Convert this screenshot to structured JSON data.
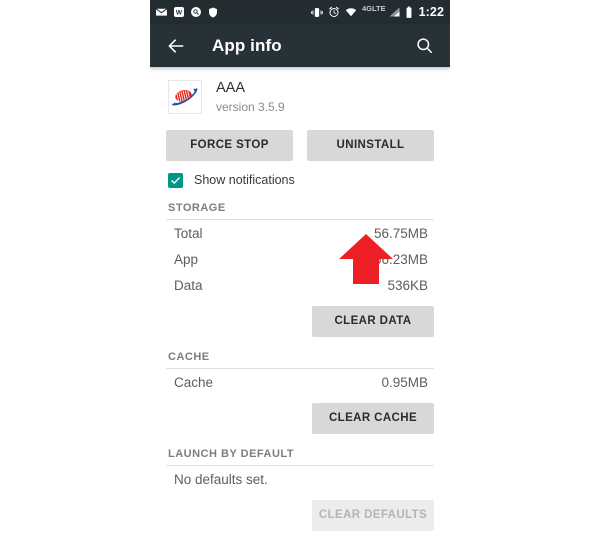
{
  "status_bar": {
    "icons_left": [
      "mail-icon",
      "w-app-icon",
      "eye-search-icon",
      "shield-icon"
    ],
    "icons_right": [
      "vibrate-icon",
      "alarm-icon",
      "wifi-icon",
      "signal-icon",
      "battery-icon"
    ],
    "network_label": "4G",
    "network_label_sub": "LTE",
    "time": "1:22"
  },
  "app_bar": {
    "back_icon": "back-arrow-icon",
    "title": "App info",
    "search_icon": "search-icon"
  },
  "app": {
    "icon": "aaa-logo-icon",
    "name": "AAA",
    "version": "version 3.5.9"
  },
  "actions": {
    "force_stop": "FORCE STOP",
    "uninstall": "UNINSTALL"
  },
  "notifications": {
    "checkbox_state": "checked",
    "label": "Show notifications"
  },
  "storage": {
    "heading": "STORAGE",
    "rows": [
      {
        "label": "Total",
        "value": "56.75MB"
      },
      {
        "label": "App",
        "value": "56.23MB"
      },
      {
        "label": "Data",
        "value": "536KB"
      }
    ],
    "clear_button": "CLEAR DATA"
  },
  "cache": {
    "heading": "CACHE",
    "rows": [
      {
        "label": "Cache",
        "value": "0.95MB"
      }
    ],
    "clear_button": "CLEAR CACHE"
  },
  "launch_by_default": {
    "heading": "LAUNCH BY DEFAULT",
    "status": "No defaults set.",
    "clear_button": "CLEAR DEFAULTS"
  },
  "annotation": {
    "arrow": "red-up-arrow-annotation",
    "color": "#ee1f25"
  },
  "colors": {
    "status_bar": "#222c31",
    "app_bar": "#263238",
    "checkbox": "#009688",
    "button": "#d8d8d8",
    "annotation_red": "#ee1f25"
  }
}
